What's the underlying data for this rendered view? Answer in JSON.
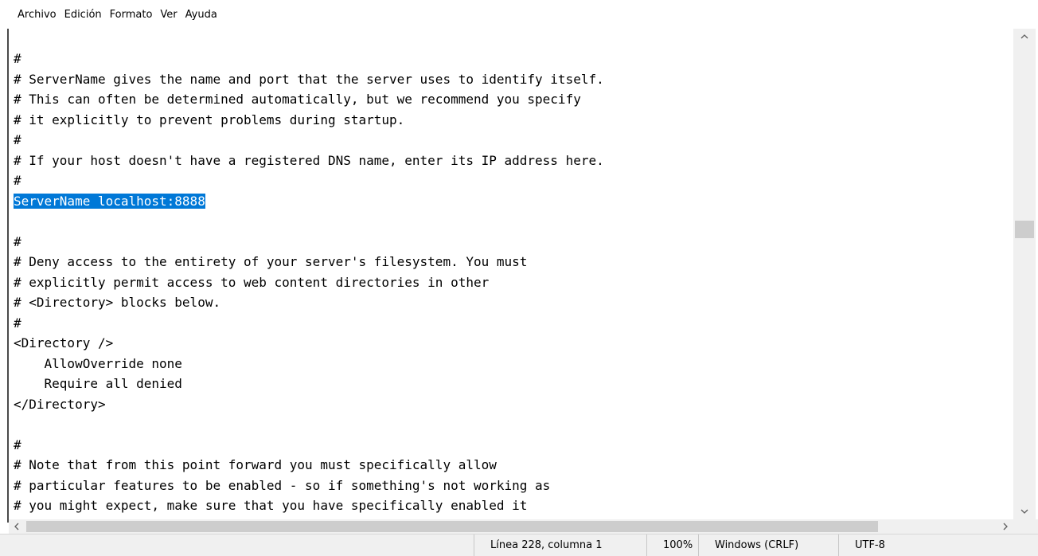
{
  "menu": {
    "items": [
      "Archivo",
      "Edición",
      "Formato",
      "Ver",
      "Ayuda"
    ]
  },
  "editor": {
    "lines": [
      "#",
      "# ServerName gives the name and port that the server uses to identify itself.",
      "# This can often be determined automatically, but we recommend you specify",
      "# it explicitly to prevent problems during startup.",
      "#",
      "# If your host doesn't have a registered DNS name, enter its IP address here.",
      "#",
      "ServerName localhost:8888",
      "",
      "#",
      "# Deny access to the entirety of your server's filesystem. You must",
      "# explicitly permit access to web content directories in other",
      "# <Directory> blocks below.",
      "#",
      "<Directory />",
      "    AllowOverride none",
      "    Require all denied",
      "</Directory>",
      "",
      "#",
      "# Note that from this point forward you must specifically allow",
      "# particular features to be enabled - so if something's not working as",
      "# you might expect, make sure that you have specifically enabled it"
    ],
    "selected_line": 7
  },
  "status": {
    "position": "Línea 228, columna 1",
    "zoom": "100%",
    "line_ending": "Windows (CRLF)",
    "encoding": "UTF-8"
  },
  "icons": {
    "scroll_up": "chevron-up-icon",
    "scroll_down": "chevron-down-icon",
    "scroll_left": "chevron-left-icon",
    "scroll_right": "chevron-right-icon"
  },
  "colors": {
    "selection": "#0078d7"
  }
}
